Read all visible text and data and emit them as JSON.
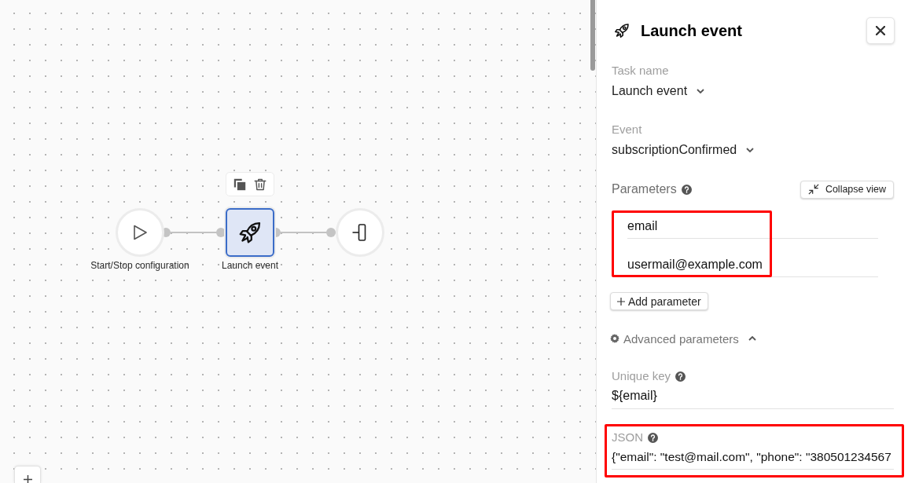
{
  "canvas": {
    "node_toolbar": {
      "actions": [
        {
          "kind": "copy"
        },
        {
          "kind": "delete"
        }
      ]
    },
    "nodes": [
      {
        "kind": "start",
        "label": "Start/Stop configuration",
        "selected": false
      },
      {
        "kind": "task",
        "label": "Launch event",
        "selected": true
      },
      {
        "kind": "end",
        "selected": false
      }
    ]
  },
  "panel": {
    "title": "Launch event",
    "task_name": {
      "label": "Task name",
      "value": "Launch event"
    },
    "event": {
      "label": "Event",
      "value": "subscriptionConfirmed"
    },
    "parameters": {
      "label": "Parameters",
      "collapse_button": "Collapse view",
      "highlighted": true,
      "items": [
        {
          "key": "email",
          "value": "usermail@example.com"
        }
      ],
      "add_button": "Add parameter"
    },
    "advanced": {
      "label": "Advanced parameters",
      "expanded": true,
      "unique_key": {
        "label": "Unique key",
        "value": "${email}"
      },
      "json": {
        "label": "JSON",
        "value": "{\"email\": \"test@mail.com\", \"phone\": \"380501234567",
        "highlighted": true
      }
    }
  }
}
